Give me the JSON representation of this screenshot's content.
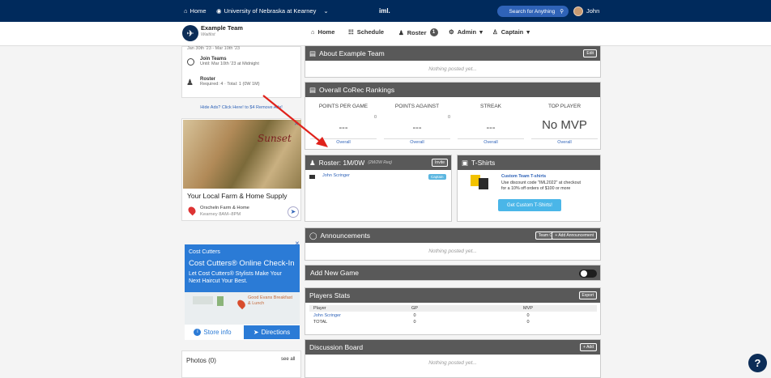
{
  "topbar": {
    "home": "Home",
    "university": "University of Nebraska at Kearney",
    "brand": "imleagues",
    "search_label": "Search for Anything",
    "user": "John"
  },
  "team": {
    "name": "Example Team",
    "sub": "Waitlist"
  },
  "nav": {
    "home": "Home",
    "schedule": "Schedule",
    "roster": "Roster",
    "roster_count": "1",
    "admin": "Admin",
    "captain": "Captain"
  },
  "left": {
    "dates_partial": "Jan 30th '23 - Mar 10th '23",
    "join_title": "Join Teams",
    "join_sub": "Until: Mar 10th '23 at Midnight",
    "roster_title": "Roster",
    "roster_sub": "Required: 4 · Total: 1 (0W 1M)",
    "hide_ads": "Hide Ads? Click Here! to $4 Remove Ads!"
  },
  "ad1": {
    "title": "Your Local Farm & Home Supply",
    "store": "Orscheln Farm & Home",
    "hours": "Kearney 8AM–8PM",
    "brand_text": "Sunset"
  },
  "ad2": {
    "brand": "Cost Cutters",
    "headline": "Cost Cutters® Online Check-In",
    "body": "Let Cost Cutters® Stylists Make Your Next Haircut Your Best.",
    "map_label": "Good Evans Breakfast & Lunch",
    "store_info": "Store info",
    "directions": "Directions"
  },
  "photos": {
    "title": "Photos (0)",
    "see_all": "see all"
  },
  "about": {
    "title": "About Example Team",
    "edit": "Edit",
    "empty": "Nothing posted yet..."
  },
  "rankings": {
    "title": "Overall CoRec Rankings",
    "cols": [
      {
        "label": "POINTS PER GAME",
        "small": "0",
        "value": "---",
        "foot": "Overall"
      },
      {
        "label": "POINTS AGAINST",
        "small": "0",
        "value": "---",
        "foot": "Overall"
      },
      {
        "label": "STREAK",
        "small": "",
        "value": "---",
        "foot": "Overall"
      },
      {
        "label": "TOP PLAYER",
        "small": "",
        "value": "No MVP",
        "foot": "Overall"
      }
    ]
  },
  "roster": {
    "title": "Roster: 1M/0W",
    "req": "(2M/2W Req)",
    "invite": "Invite",
    "player": "John Scringer",
    "captain": "Captain"
  },
  "tshirts": {
    "title": "T-Shirts",
    "headline": "Custom Team T-shirts",
    "line1": "Use discount code \"IML2022\" at checkout",
    "line2": "for a 10% off orders of $100 or more",
    "cta": "Get Custom T-Shirts!"
  },
  "announcements": {
    "title": "Announcements",
    "team_chat": "Team Chat",
    "add": "+ Add Announcement",
    "empty": "Nothing posted yet..."
  },
  "addgame": {
    "title": "Add New Game"
  },
  "players": {
    "title": "Players Stats",
    "export": "Export",
    "headers": [
      "Player",
      "GP",
      "MVP"
    ],
    "rows": [
      {
        "player": "John Scringer",
        "gp": "0",
        "mvp": "0"
      },
      {
        "player": "TOTAL",
        "gp": "0",
        "mvp": "0"
      }
    ]
  },
  "discussion": {
    "title": "Discussion Board",
    "add": "+ Add",
    "empty": "Nothing posted yet..."
  },
  "colors": {
    "navy": "#002a5c",
    "panel_header": "#595959",
    "link": "#2f63b8",
    "arrow": "#e0221b",
    "cta": "#4ab6e8"
  }
}
